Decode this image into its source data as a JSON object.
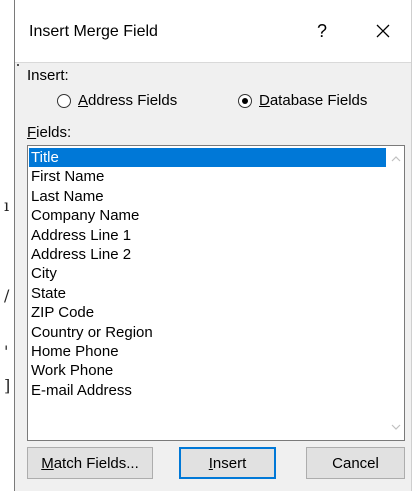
{
  "dialog": {
    "title": "Insert Merge Field",
    "help_glyph": "?",
    "close_icon": "close-icon"
  },
  "insert": {
    "label_prefix": "Insert:",
    "options": [
      {
        "label_hot": "A",
        "label_rest": "ddress Fields",
        "checked": false
      },
      {
        "label_hot": "D",
        "label_rest": "atabase Fields",
        "checked": true
      }
    ]
  },
  "fields": {
    "label_hot": "F",
    "label_rest": "ields:",
    "items": [
      "Title",
      "First Name",
      "Last Name",
      "Company Name",
      "Address Line 1",
      "Address Line 2",
      "City",
      "State",
      "ZIP Code",
      "Country or Region",
      "Home Phone",
      "Work Phone",
      "E-mail Address"
    ],
    "selected_index": 0
  },
  "buttons": {
    "match_hot": "M",
    "match_rest": "atch Fields...",
    "insert_hot": "I",
    "insert_rest": "nsert",
    "cancel": "Cancel"
  },
  "colors": {
    "selection": "#0078d7",
    "dialog_bg": "#f0f0f0"
  }
}
